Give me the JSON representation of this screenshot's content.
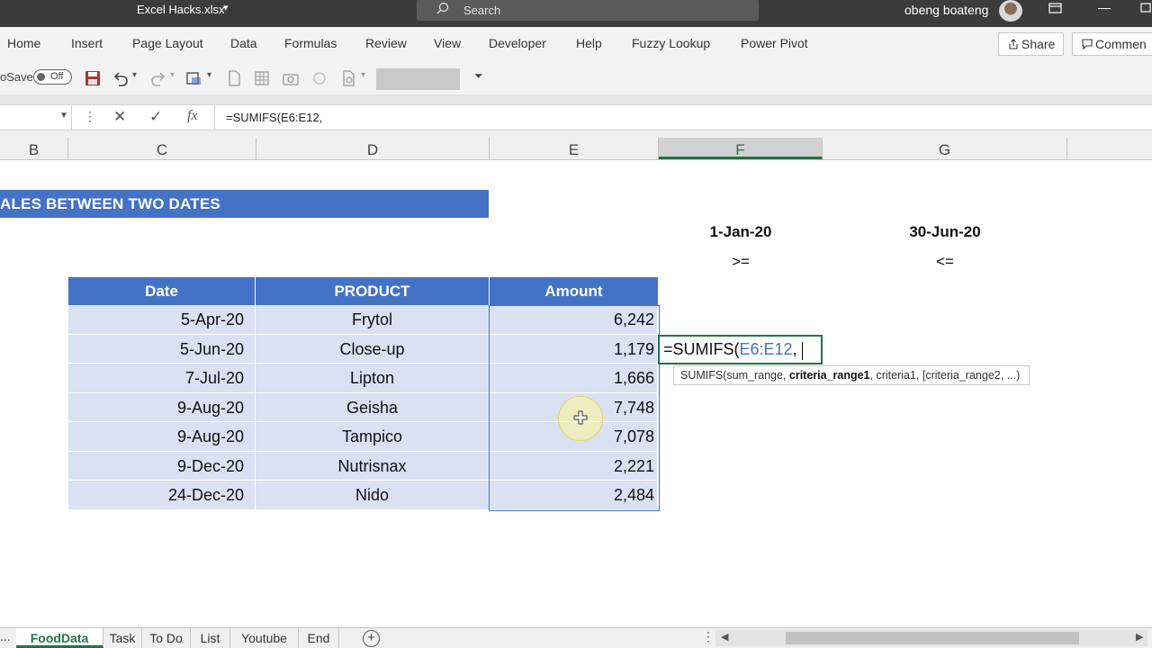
{
  "window": {
    "title": "Excel Hacks.xlsx",
    "search_placeholder": "Search",
    "user_name": "obeng boateng"
  },
  "ribbon": {
    "tabs": [
      "Home",
      "Insert",
      "Page Layout",
      "Data",
      "Formulas",
      "Review",
      "View",
      "Developer",
      "Help",
      "Fuzzy Lookup",
      "Power Pivot"
    ],
    "share_label": "Share",
    "comments_label": "Commen"
  },
  "qat": {
    "autosave_label": "oSave",
    "autosave_state": "Off"
  },
  "formula_bar": {
    "formula": "=SUMIFS(E6:E12,"
  },
  "columns": [
    "B",
    "C",
    "D",
    "E",
    "F",
    "G"
  ],
  "selected_column": "F",
  "sheet": {
    "banner": "ALES BETWEEN TWO DATES",
    "start_date": "1-Jan-20",
    "start_operator": ">=",
    "end_date": "30-Jun-20",
    "end_operator": "<=",
    "headers": [
      "Date",
      "PRODUCT",
      "Amount"
    ],
    "rows": [
      [
        "5-Apr-20",
        "Frytol",
        "6,242"
      ],
      [
        "5-Jun-20",
        "Close-up",
        "1,179"
      ],
      [
        "7-Jul-20",
        "Lipton",
        "1,666"
      ],
      [
        "9-Aug-20",
        "Geisha",
        "7,748"
      ],
      [
        "9-Aug-20",
        "Tampico",
        "7,078"
      ],
      [
        "9-Dec-20",
        "Nutrisnax",
        "2,221"
      ],
      [
        "24-Dec-20",
        "Nido",
        "2,484"
      ]
    ],
    "active_cell": {
      "prefix": "=SUMIFS(",
      "range": "E6:E12",
      "suffix": ","
    },
    "tooltip": {
      "fn": "SUMIFS(sum_range, ",
      "current_arg": "criteria_range1",
      "rest": ", criteria1, [criteria_range2, ...)"
    }
  },
  "sheet_tabs": [
    "FoodData",
    "Task",
    "To Do",
    "List",
    "Youtube",
    "End"
  ],
  "active_sheet": "FoodData",
  "tab_overflow": "...",
  "colors": {
    "title_bar": "#3b3b3b",
    "header_blue": "#4472c4",
    "row_fill": "#d9e1f2",
    "excel_green": "#217346"
  }
}
